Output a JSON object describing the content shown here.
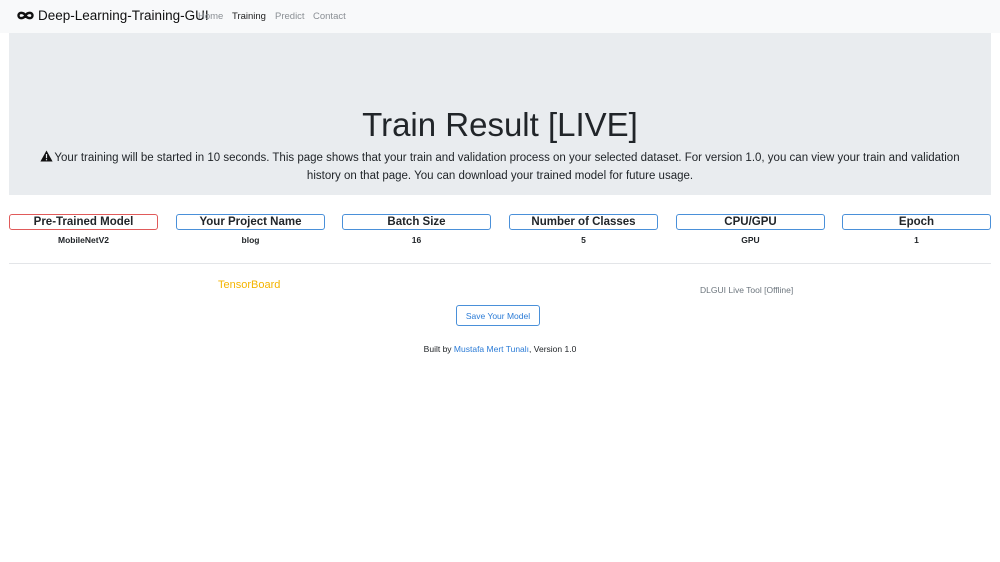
{
  "navbar": {
    "brand_icon": "infinity-icon",
    "brand": "Deep-Learning-Training-GUI",
    "links": [
      "Home",
      "Training",
      "Predict",
      "Contact"
    ],
    "active": "Training"
  },
  "jumbotron": {
    "title": "Train Result [LIVE]",
    "warning_icon": "warning-icon",
    "lead": "Your training will be started in 10 seconds. This page shows that your train and validation process on your selected dataset. For version 1.0, you can view your train and validation history on that page. You can download your trained model for future usage."
  },
  "info": [
    {
      "label": "Pre-Trained Model",
      "value": "MobileNetV2"
    },
    {
      "label": "Your Project Name",
      "value": "blog"
    },
    {
      "label": "Batch Size",
      "value": "16"
    },
    {
      "label": "Number of Classes",
      "value": "5"
    },
    {
      "label": "CPU/GPU",
      "value": "GPU"
    },
    {
      "label": "Epoch",
      "value": "1"
    }
  ],
  "links": {
    "tensorboard": "TensorBoard",
    "live_tool": "DLGUI Live Tool [Offline]"
  },
  "save_button": "Save Your Model",
  "footer": {
    "prefix": "Built by",
    "author": "Mustafa Mert Tunalı",
    "suffix": ", Version 1.0"
  },
  "colors": {
    "navbar_bg": "#f8f9fa",
    "jumbotron_bg": "#e9ecef",
    "box_border": "#4a90d9",
    "active_box_border": "#e05a5a",
    "tensorboard_link": "#f4b400",
    "link": "#2b7bd6"
  }
}
